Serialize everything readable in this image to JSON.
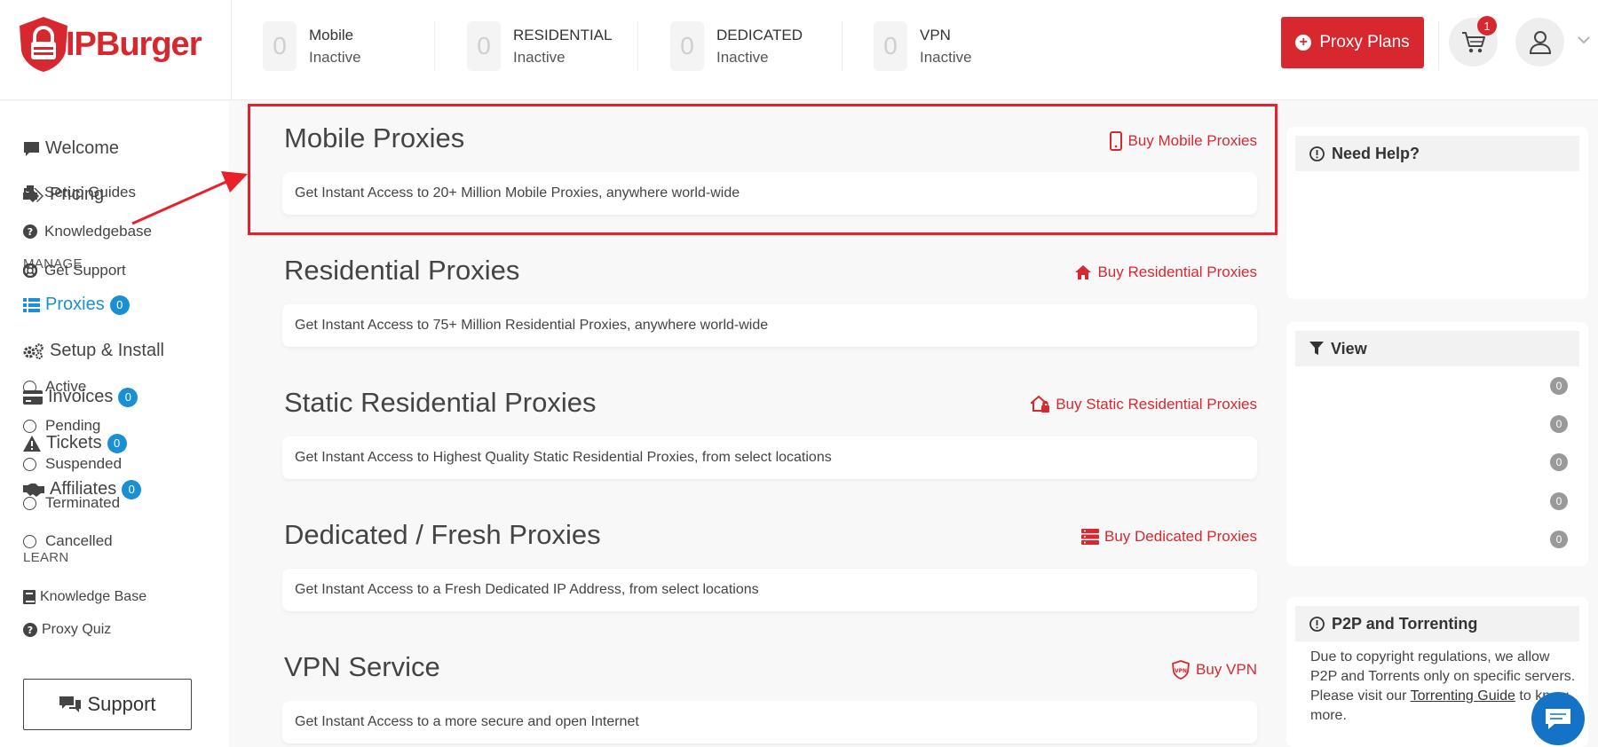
{
  "brand": {
    "logo_text": "IPBurger",
    "accent": "#d8282f",
    "blue": "#1a8fd3"
  },
  "stats": [
    {
      "count": "0",
      "name": "Mobile",
      "state": "Inactive"
    },
    {
      "count": "0",
      "name": "RESIDENTIAL",
      "state": "Inactive"
    },
    {
      "count": "0",
      "name": "DEDICATED",
      "state": "Inactive"
    },
    {
      "count": "0",
      "name": "VPN",
      "state": "Inactive"
    }
  ],
  "header": {
    "proxy_plans_label": "Proxy Plans",
    "cart_count": "1"
  },
  "sidebar": {
    "welcome": "Welcome",
    "pricing": "Pricing",
    "manage_label": "MANAGE",
    "proxies": "Proxies",
    "proxies_count": "0",
    "setup": "Setup & Install",
    "invoices": "Invoices",
    "invoices_count": "0",
    "tickets": "Tickets",
    "tickets_count": "0",
    "affiliates": "Affiliates",
    "affiliates_count": "0",
    "learn_label": "LEARN",
    "knowledge_base": "Knowledge Base",
    "proxy_quiz": "Proxy Quiz",
    "support": "Support"
  },
  "sections": [
    {
      "title": "Mobile Proxies",
      "buy": "Buy Mobile Proxies",
      "desc": "Get Instant Access to 20+ Million Mobile Proxies, anywhere world-wide"
    },
    {
      "title": "Residential Proxies",
      "buy": "Buy Residential Proxies",
      "desc": "Get Instant Access to 75+ Million Residential Proxies, anywhere world-wide"
    },
    {
      "title": "Static Residential Proxies",
      "buy": "Buy Static Residential Proxies",
      "desc": "Get Instant Access to Highest Quality Static Residential Proxies, from select locations"
    },
    {
      "title": "Dedicated / Fresh Proxies",
      "buy": "Buy Dedicated Proxies",
      "desc": "Get Instant Access to a Fresh Dedicated IP Address, from select locations"
    },
    {
      "title": "VPN Service",
      "buy": "Buy VPN",
      "desc": "Get Instant Access to a more secure and open Internet"
    }
  ],
  "help": {
    "title": "Need Help?",
    "setup_guides": "Setup Guides",
    "knowledgebase": "Knowledgebase",
    "get_support": "Get Support"
  },
  "view": {
    "title": "View",
    "filters": [
      {
        "label": "Active",
        "count": "0"
      },
      {
        "label": "Pending",
        "count": "0"
      },
      {
        "label": "Suspended",
        "count": "0"
      },
      {
        "label": "Terminated",
        "count": "0"
      },
      {
        "label": "Cancelled",
        "count": "0"
      }
    ]
  },
  "p2p": {
    "title": "P2P and Torrenting",
    "text_before": "Due to copyright regulations, we allow P2P and Torrents only on specific servers. Please visit our ",
    "link": "Torrenting Guide",
    "text_after": " to know more."
  }
}
